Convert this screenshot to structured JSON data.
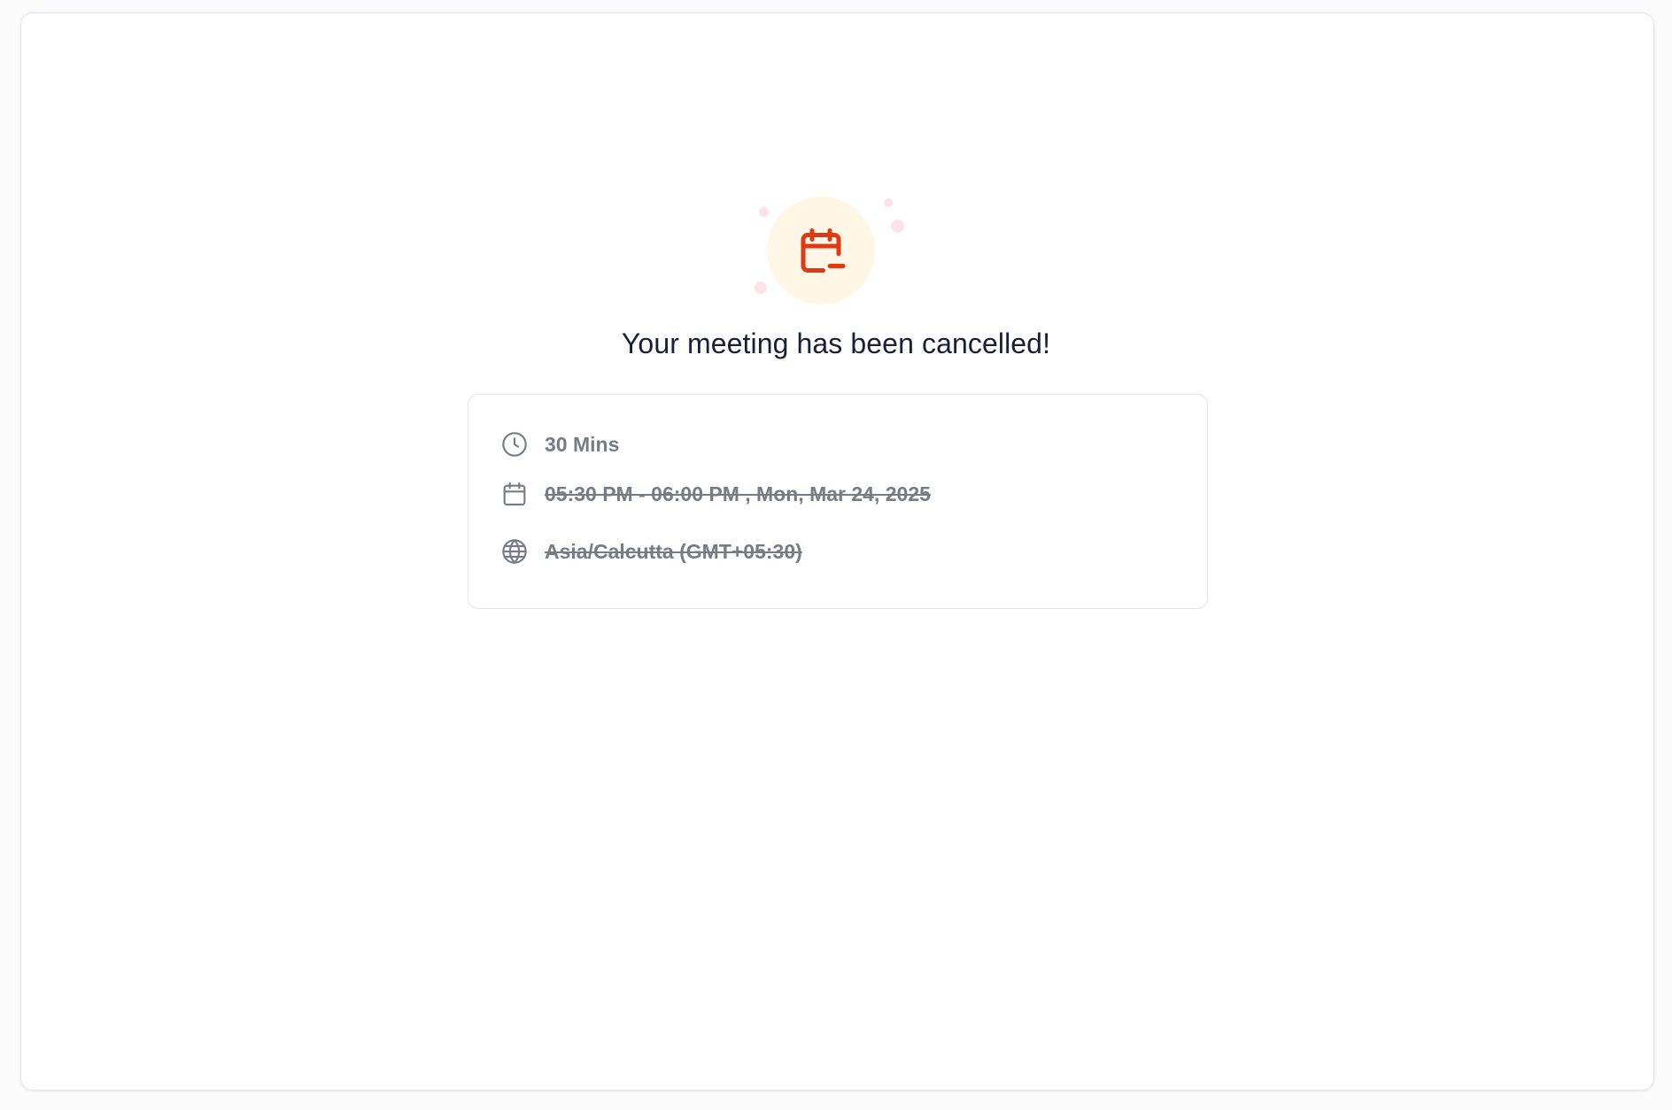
{
  "status": {
    "title": "Your meeting has been cancelled!",
    "icon": "calendar-minus-icon",
    "accent_color": "#e03a12",
    "halo_color": "#fff6e6"
  },
  "details": {
    "duration": {
      "icon": "clock-icon",
      "text": "30 Mins"
    },
    "datetime": {
      "icon": "calendar-icon",
      "text": "05:30 PM - 06:00 PM , Mon, Mar 24, 2025"
    },
    "timezone": {
      "icon": "globe-icon",
      "text": "Asia/Calcutta (GMT+05:30)"
    }
  }
}
